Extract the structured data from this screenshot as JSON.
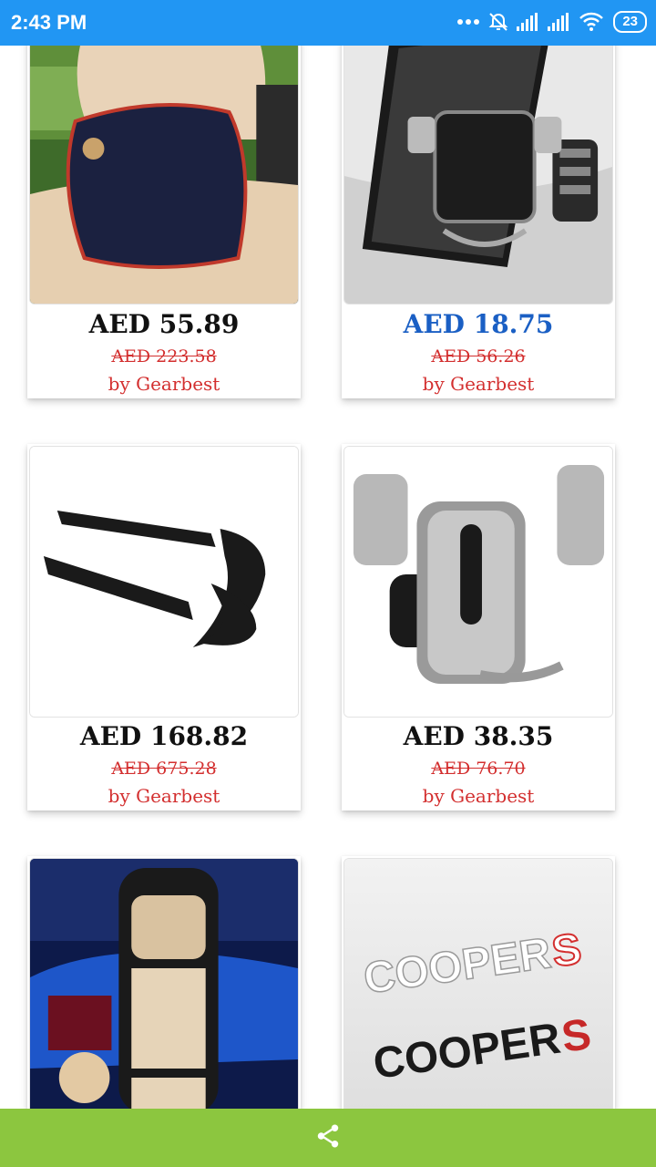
{
  "status_bar": {
    "time": "2:43 PM",
    "battery": "23",
    "icons": [
      "more-dots-icon",
      "alarm-off-icon",
      "signal-icon",
      "signal-icon",
      "wifi-icon",
      "battery-icon"
    ]
  },
  "products": [
    {
      "price": "AED 55.89",
      "old_price": "AED 223.58",
      "seller": "by Gearbest",
      "image": "neck-pillow"
    },
    {
      "price": "AED 18.75",
      "old_price": "AED 56.26",
      "seller": "by Gearbest",
      "image": "phone-holder",
      "price_color": "#1a5fc4"
    },
    {
      "price": "AED 168.82",
      "old_price": "AED 675.28",
      "seller": "by Gearbest",
      "image": "v8-biturbo-emblem"
    },
    {
      "price": "AED 38.35",
      "old_price": "AED 76.70",
      "seller": "by Gearbest",
      "image": "gravity-phone-mount"
    },
    {
      "image": "car-seat-cover"
    },
    {
      "image": "cooper-s-emblem",
      "emblem_text": [
        "COOPER",
        "S"
      ]
    }
  ],
  "bottom_bar": {
    "icon": "share-icon",
    "color": "#8cc63f"
  },
  "colors": {
    "status_bar": "#2196f3",
    "old_price": "#d32f2f",
    "seller": "#d32f2f"
  }
}
